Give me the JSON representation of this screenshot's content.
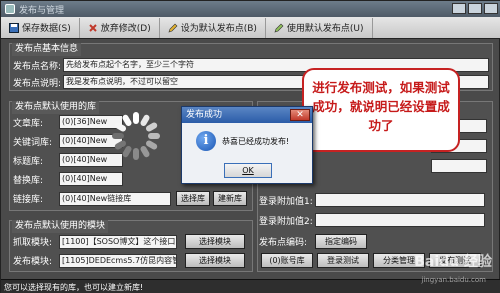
{
  "window": {
    "title": "发布与管理"
  },
  "toolbar": {
    "items": [
      {
        "label": "保存数据(S)"
      },
      {
        "label": "放弃修改(D)"
      },
      {
        "label": "设为默认发布点(B)"
      },
      {
        "label": "使用默认发布点(U)"
      }
    ]
  },
  "basic": {
    "group_title": "发布点基本信息",
    "name_label": "发布点名称:",
    "name_value": "先给发布点起个名字，至少三个字符",
    "desc_label": "发布点说明:",
    "desc_value": "我是发布点说明，不过可以留空"
  },
  "libs": {
    "group_title": "发布点默认使用的库",
    "rows": [
      {
        "label": "文章库:",
        "value": "(0)[36]New"
      },
      {
        "label": "关键词库:",
        "value": "(0)[40]New"
      },
      {
        "label": "标题库:",
        "value": "(0)[40]New"
      },
      {
        "label": "替换库:",
        "value": "(0)[40]New"
      },
      {
        "label": "链接库:",
        "value": "(0)[40]New链接库"
      }
    ],
    "select_label": "选择库",
    "new_label": "建新库"
  },
  "modules": {
    "group_title": "发布点默认使用的模块",
    "rows": [
      {
        "label": "抓取模块:",
        "value": "[1100]【SOSO博文】这个接口",
        "button": "选择模块"
      },
      {
        "label": "发布模块:",
        "value": "[1105]DEDEcms5.7仿昆内容管",
        "button": "选择模块"
      }
    ]
  },
  "right": {
    "extra1_label": "登录附加值1:",
    "extra2_label": "登录附加值2:",
    "encoding_label": "发布点编码:",
    "encoding_button": "指定编码",
    "buttons": [
      "(0)账号库",
      "登录测试",
      "分类管理",
      "发布测试"
    ]
  },
  "dialog": {
    "title": "发布成功",
    "close": "✕",
    "message": "恭喜已经成功发布!",
    "ok": "OK"
  },
  "callout": {
    "text": "进行发布测试，如果测试成功，就说明已经设置成功了"
  },
  "statusbar": {
    "text": "您可以选择现有的库，也可以建立新库!"
  },
  "watermark": {
    "text": "Baidu 经验",
    "sub": "jingyan.baidu.com"
  }
}
